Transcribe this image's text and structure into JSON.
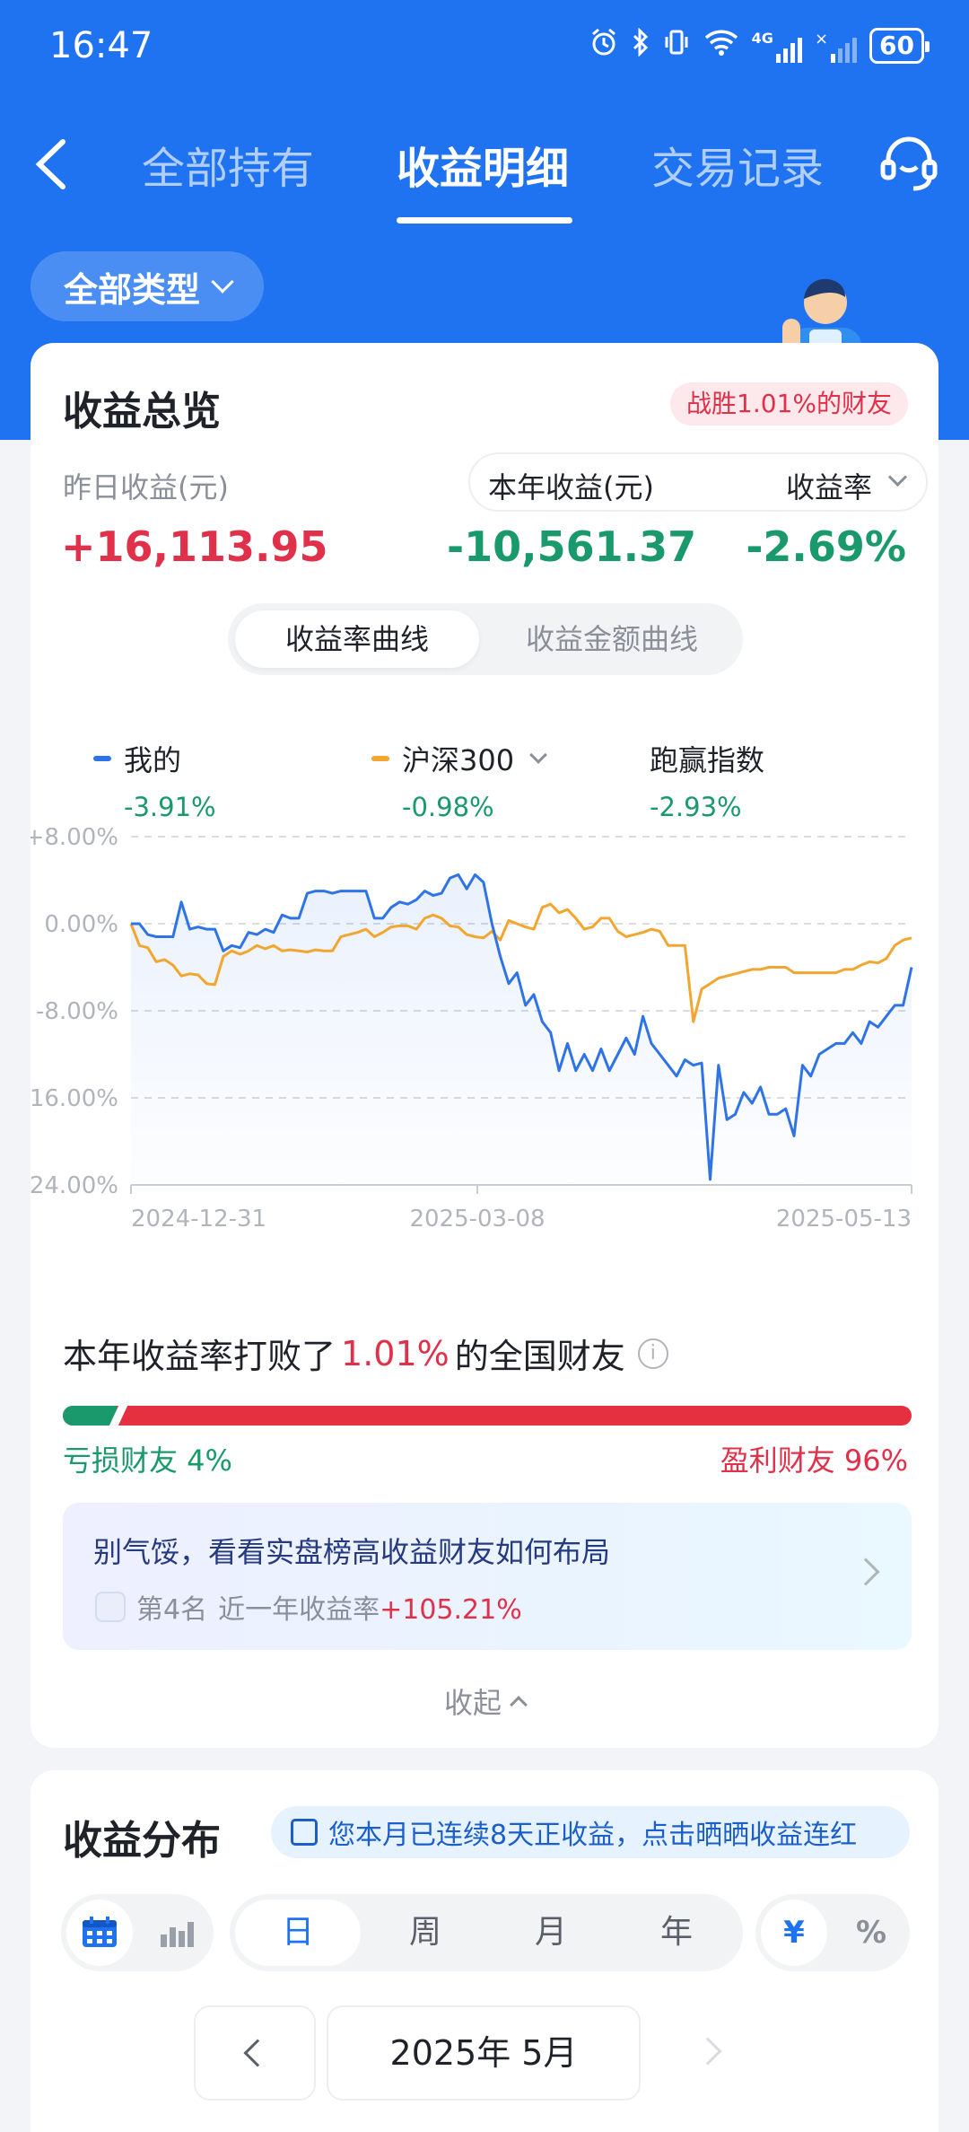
{
  "status_bar": {
    "time": "16:47",
    "battery": "60",
    "network": "4G"
  },
  "nav": {
    "tabs": [
      {
        "label": "全部持有",
        "active": false
      },
      {
        "label": "收益明细",
        "active": true
      },
      {
        "label": "交易记录",
        "active": false
      }
    ]
  },
  "filter": {
    "type_label": "全部类型"
  },
  "overview": {
    "title": "收益总览",
    "beat_badge": "战胜1.01%的财友",
    "yesterday_label": "昨日收益(元)",
    "yesterday_value": "+16,113.95",
    "year_label": "本年收益(元)",
    "year_value": "-10,561.37",
    "rate_label": "收益率",
    "rate_value": "-2.69%"
  },
  "curve_toggle": {
    "rate_curve": "收益率曲线",
    "amount_curve": "收益金额曲线",
    "selected": "rate_curve"
  },
  "legend": [
    {
      "name": "我的",
      "value": "-3.91%",
      "color": "#2f74e6"
    },
    {
      "name": "沪深300",
      "value": "-0.98%",
      "color": "#f2a630"
    },
    {
      "name": "跑赢指数",
      "value": "-2.93%"
    }
  ],
  "chart_data": {
    "type": "line",
    "y_ticks": [
      "+8.00%",
      "0.00%",
      "-8.00%",
      "-16.00%",
      "-24.00%"
    ],
    "ylim": [
      -24,
      8
    ],
    "x_ticks": [
      "2024-12-31",
      "2025-03-08",
      "2025-05-13"
    ],
    "grid": true,
    "series": [
      {
        "name": "我的",
        "color": "#2f74e6",
        "values": [
          0,
          0,
          -1.0,
          -1.2,
          -1.2,
          -1.2,
          2.0,
          -0.5,
          -0.3,
          -0.5,
          -0.5,
          -2.5,
          -2.0,
          -2.2,
          -0.8,
          -1.0,
          -0.5,
          -0.8,
          0.8,
          0.5,
          0.5,
          2.8,
          3.0,
          3.0,
          2.8,
          3.0,
          3.0,
          3.0,
          3.0,
          0.5,
          0.5,
          1.5,
          2.0,
          1.8,
          2.2,
          3.0,
          2.6,
          2.8,
          4.2,
          4.5,
          3.2,
          4.5,
          3.8,
          0,
          -3.0,
          -5.5,
          -4.5,
          -7.5,
          -6.5,
          -9.0,
          -10.0,
          -13.5,
          -11.0,
          -13.5,
          -12.0,
          -13.5,
          -11.5,
          -13.5,
          -12.0,
          -10.5,
          -12.0,
          -8.5,
          -11.0,
          -12.0,
          -13.0,
          -14.0,
          -12.5,
          -13.0,
          -12.8,
          -23.5,
          -13.0,
          -18.0,
          -17.5,
          -15.5,
          -16.5,
          -15.0,
          -17.5,
          -17.5,
          -17.0,
          -19.5,
          -13.0,
          -14.0,
          -12.0,
          -11.5,
          -11.0,
          -11.0,
          -10.0,
          -11.0,
          -9.0,
          -9.5,
          -8.5,
          -7.5,
          -7.5,
          -4.0
        ]
      },
      {
        "name": "沪深300",
        "color": "#f2a630",
        "values": [
          0,
          -2.0,
          -2.2,
          -3.5,
          -3.3,
          -3.8,
          -4.8,
          -4.6,
          -4.7,
          -5.5,
          -5.6,
          -3.0,
          -2.5,
          -2.8,
          -2.5,
          -2.0,
          -2.3,
          -2.0,
          -2.5,
          -2.4,
          -2.5,
          -2.6,
          -2.4,
          -2.5,
          -2.5,
          -1.2,
          -1.0,
          -0.8,
          -0.5,
          -1.2,
          -0.8,
          -0.3,
          -0.2,
          -0.2,
          -0.5,
          0.5,
          0.8,
          0.5,
          -0.2,
          -0.3,
          -1.0,
          -1.2,
          -1.3,
          -0.7,
          -1.5,
          0.3,
          0.0,
          -0.3,
          -0.5,
          1.5,
          1.8,
          1.0,
          1.3,
          0.5,
          -0.5,
          -0.3,
          0.5,
          0.5,
          -0.7,
          -1.2,
          -1.0,
          -0.8,
          -0.5,
          -0.7,
          -2.0,
          -2.0,
          -2.0,
          -9.0,
          -6.0,
          -5.5,
          -5.0,
          -4.8,
          -4.6,
          -4.4,
          -4.2,
          -4.2,
          -4.0,
          -4.0,
          -4.0,
          -4.5,
          -4.5,
          -4.5,
          -4.5,
          -4.5,
          -4.5,
          -4.2,
          -4.2,
          -3.8,
          -3.5,
          -3.6,
          -3.2,
          -2.0,
          -1.5,
          -1.3
        ]
      }
    ]
  },
  "beat_section": {
    "prefix": "本年收益率打败了",
    "percent": "1.01%",
    "suffix": "的全国财友",
    "loss_label": "亏损财友 4%",
    "win_label": "盈利财友 96%",
    "loss_fraction": 0.04
  },
  "promo": {
    "title": "别气馁，看看实盘榜高收益财友如何布局",
    "rank": "第4名",
    "desc": "近一年收益率",
    "value": "+105.21%"
  },
  "collapse_label": "收起",
  "distribution": {
    "title": "收益分布",
    "streak_text": "您本月已连续8天正收益，点击晒晒收益连红",
    "periods": [
      "日",
      "周",
      "月",
      "年"
    ],
    "selected_period": "日",
    "units": [
      "¥",
      "%"
    ],
    "selected_unit": "¥",
    "month": "2025年 5月"
  }
}
